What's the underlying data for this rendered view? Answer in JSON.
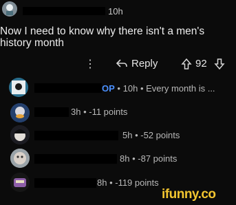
{
  "post": {
    "time": "10h",
    "text_line1": "Now I need to know why there isn't a men's",
    "text_line2": "history month"
  },
  "actions": {
    "more": "⋮",
    "reply": "Reply",
    "votes": "92"
  },
  "replies": [
    {
      "op_badge": "OP",
      "sep": "•",
      "time": "10h",
      "snippet": "Every month is ..."
    },
    {
      "meta": "3h • -11 points"
    },
    {
      "meta": "5h • -52 points"
    },
    {
      "meta": "8h • -87 points"
    },
    {
      "meta": "8h • -119 points"
    }
  ],
  "watermark": "ifunny.co",
  "colors": {
    "background": "#0b0b0b",
    "op_accent": "#4a90ff",
    "watermark": "#f2c530"
  }
}
